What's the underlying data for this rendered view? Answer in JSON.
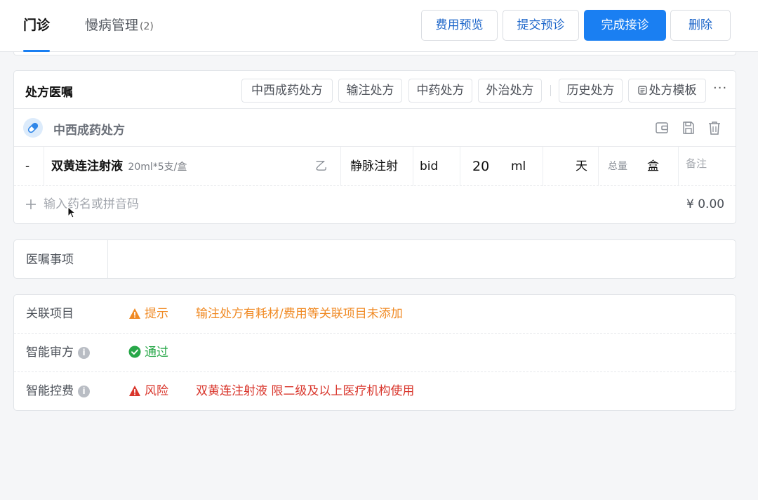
{
  "tabs": [
    {
      "label": "门诊"
    },
    {
      "label": "慢病管理",
      "count": "(2)"
    }
  ],
  "actions": [
    "费用预览",
    "提交预诊",
    "完成接诊",
    "删除"
  ],
  "prescription": {
    "title": "处方医嘱",
    "chips": [
      "中西成药处方",
      "输注处方",
      "中药处方",
      "外治处方",
      "历史处方",
      "处方模板"
    ],
    "more": "···",
    "sub_title": "中西成药处方",
    "item": {
      "index": "-",
      "name": "双黄连注射液",
      "spec": "20ml*5支/盒",
      "insurance": "乙",
      "route": "静脉注射",
      "frequency": "bid",
      "dose": "20",
      "unit": "ml",
      "days_unit": "天",
      "total_label": "总量",
      "total_unit": "盒",
      "remark_placeholder": "备注"
    },
    "add_placeholder": "输入药名或拼音码",
    "total_price": "¥ 0.00"
  },
  "note": {
    "label": "医嘱事项",
    "value": ""
  },
  "checks": [
    {
      "label": "关联项目",
      "info": false,
      "status": "提示",
      "level": "warn",
      "message": "输注处方有耗材/费用等关联项目未添加"
    },
    {
      "label": "智能审方",
      "info": true,
      "status": "通过",
      "level": "ok",
      "message": ""
    },
    {
      "label": "智能控费",
      "info": true,
      "status": "风险",
      "level": "risk",
      "message": "双黄连注射液 限二级及以上医疗机构使用"
    }
  ],
  "colors": {
    "primary": "#1a7ff2",
    "warn": "#f08a24",
    "ok": "#27a748",
    "risk": "#d9352b"
  }
}
